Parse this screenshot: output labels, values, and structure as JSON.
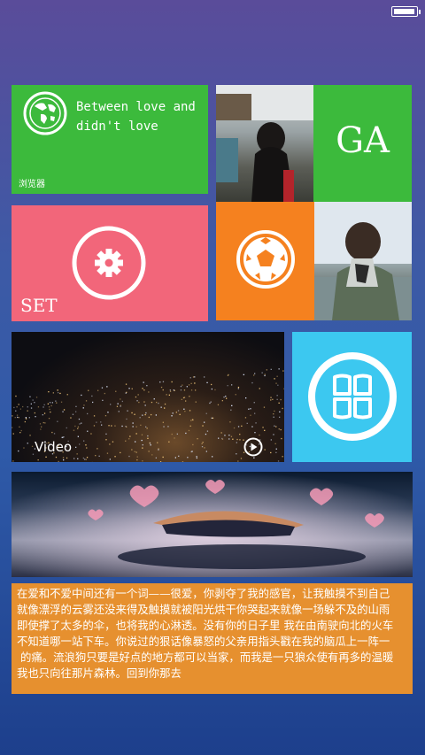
{
  "status_bar": {
    "battery_level": 0.9,
    "battery_icon": "battery-icon"
  },
  "tiles": {
    "browser": {
      "slogan": "Between love and didn't love",
      "label": "浏览器",
      "icon": "globe-icon",
      "color": "#3cba3c"
    },
    "ga": {
      "text": "GA",
      "color": "#3cba3c"
    },
    "set": {
      "label": "SET",
      "icon": "gear-icon",
      "color": "#f2667a"
    },
    "ball": {
      "icon": "soccer-ball-icon",
      "color": "#f5811f"
    },
    "video": {
      "label": "Video",
      "icon": "play-icon"
    },
    "cyan": {
      "icon": "windows-logo-icon",
      "color": "#3cc8f0"
    },
    "text_block": {
      "color": "#e6902f",
      "lines": [
        "在爱和不爱中间还有一个词——很爱，你剥夺了我的感官，让我触摸不到自己",
        "就像漂浮的云雾还没来得及触摸就被阳光烘干你哭起来就像一场躲不及的山雨",
        "即使撑了太多的伞，也将我的心淋透。没有你的日子里 我在由南驶向北的火车",
        "不知道哪一站下车。你说过的狠话像暴怒的父亲用指头戳在我的脑瓜上一阵一",
        " 的痛。流浪狗只要是好点的地方都可以当家，而我是一只狼众使有再多的温暖",
        "我也只向往那片森林。回到你那去"
      ]
    }
  }
}
